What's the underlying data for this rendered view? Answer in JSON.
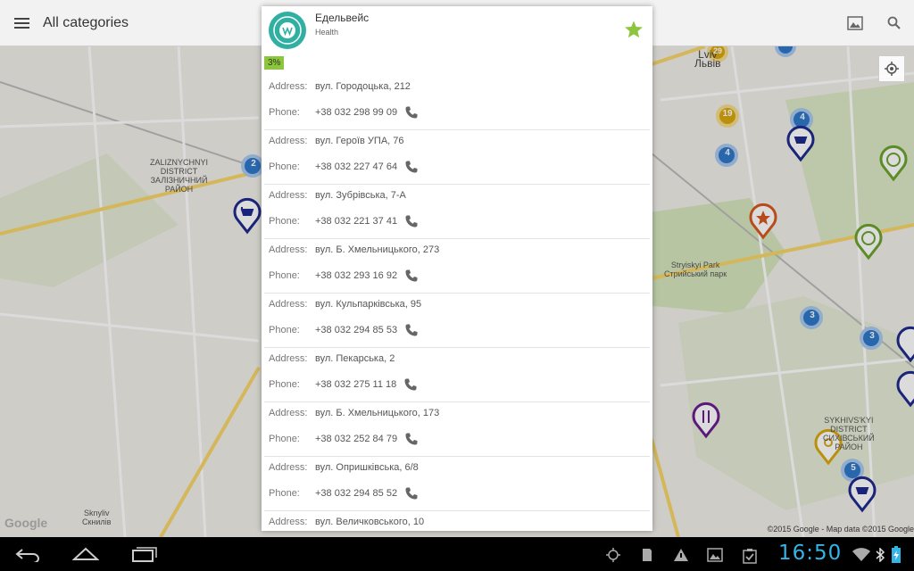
{
  "actionbar": {
    "title": "All categories",
    "menu_icon": "hamburger-icon",
    "right_icons": [
      "image-icon",
      "search-icon"
    ]
  },
  "map": {
    "labels": [
      {
        "text": "ZALIZNYCHNYI\nDISTRICT\nЗАЛІЗНИЧНИЙ\nРАЙОН"
      },
      {
        "text": "Lviv\nЛьвів"
      },
      {
        "text": "Stryiskyi Park\nСтрийський парк"
      },
      {
        "text": "SYKHIVS'KYI\nDISTRICT\nСИХІВСЬКИЙ\nРАЙОН"
      },
      {
        "text": "Sknyliv\nСкнилів"
      }
    ],
    "cluster_counts": [
      "2",
      "4",
      "4",
      "19",
      "29",
      "3",
      "3",
      "5"
    ],
    "attribution": "©2015 Google - Map data ©2015 Google",
    "google_logo": "Google",
    "colors": {
      "road_major": "#f7d56b",
      "park": "#cfe3b1",
      "cluster": "#2f78c9",
      "dim": "rgba(0,0,0,0.14)"
    }
  },
  "dialog": {
    "name": "Едельвейс",
    "category": "Health",
    "discount": "3%",
    "favorite_icon": "star-icon",
    "accent_color": "#8cc63f",
    "address_label": "Address:",
    "phone_label": "Phone:",
    "entries": [
      {
        "address": "вул. Городоцька, 212",
        "phone": "+38 032 298 99 09"
      },
      {
        "address": "вул. Героїв УПА, 76",
        "phone": "+38 032 227 47 64"
      },
      {
        "address": "вул. Зубрівська, 7-А",
        "phone": "+38 032 221 37 41"
      },
      {
        "address": "вул. Б. Хмельницького, 273",
        "phone": "+38 032 293 16 92"
      },
      {
        "address": "вул. Кульпарківська, 95",
        "phone": "+38 032 294 85 53"
      },
      {
        "address": "вул. Пекарська, 2",
        "phone": "+38 032 275 11 18"
      },
      {
        "address": "вул. Б. Хмельницького, 173",
        "phone": "+38 032 252 84 79"
      },
      {
        "address": "вул. Опришківська, 6/8",
        "phone": "+38 032 294 85 52"
      },
      {
        "address": "вул. Величковського, 10",
        "phone": ""
      }
    ]
  },
  "systembar": {
    "clock": "16:50",
    "nav_icons": [
      "back-icon",
      "home-icon",
      "recent-apps-icon"
    ],
    "status_icons": [
      "gps-icon",
      "sd-card-icon",
      "warning-icon",
      "gallery-icon",
      "clipboard-icon",
      "wifi-icon",
      "bluetooth-icon",
      "battery-icon"
    ]
  }
}
